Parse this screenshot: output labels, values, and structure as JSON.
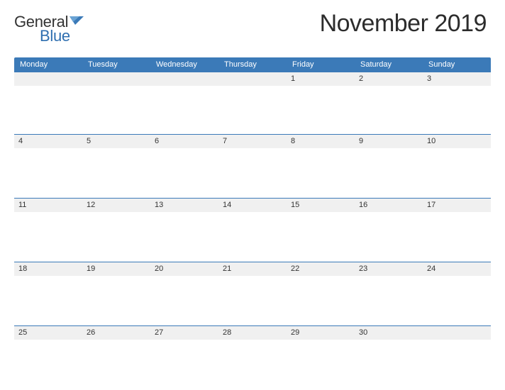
{
  "brand": {
    "part1": "General",
    "part2": "Blue"
  },
  "title": "November 2019",
  "weekdays": [
    "Monday",
    "Tuesday",
    "Wednesday",
    "Thursday",
    "Friday",
    "Saturday",
    "Sunday"
  ],
  "weeks": [
    [
      "",
      "",
      "",
      "",
      "1",
      "2",
      "3"
    ],
    [
      "4",
      "5",
      "6",
      "7",
      "8",
      "9",
      "10"
    ],
    [
      "11",
      "12",
      "13",
      "14",
      "15",
      "16",
      "17"
    ],
    [
      "18",
      "19",
      "20",
      "21",
      "22",
      "23",
      "24"
    ],
    [
      "25",
      "26",
      "27",
      "28",
      "29",
      "30",
      ""
    ]
  ],
  "colors": {
    "accent": "#3b7ab8"
  }
}
